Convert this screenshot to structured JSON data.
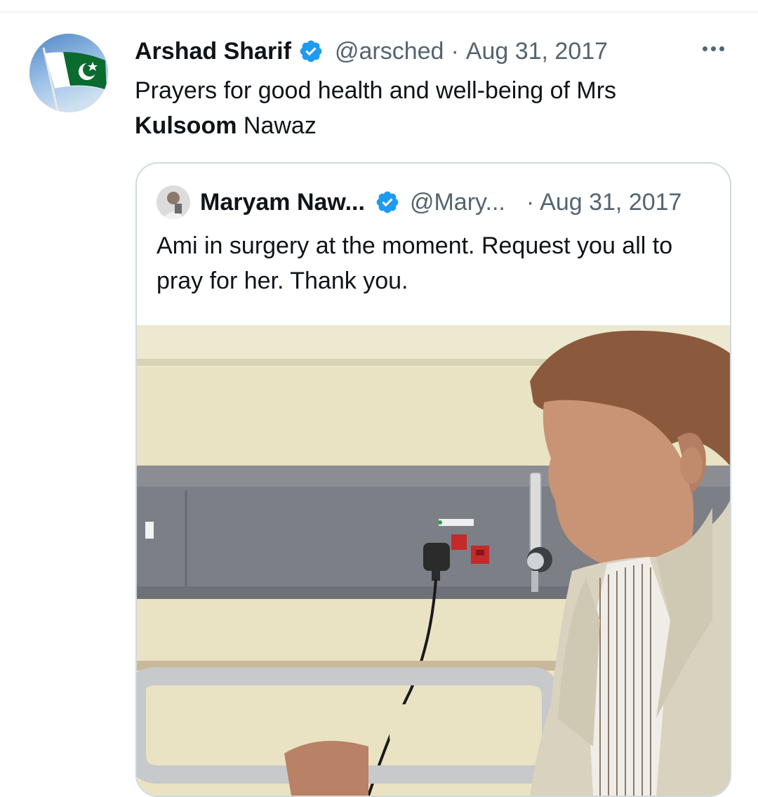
{
  "tweet": {
    "author_name": "Arshad Sharif",
    "handle": "@arsched",
    "separator": "·",
    "date": "Aug 31, 2017",
    "text_line1": "Prayers for good health and well-being of Mrs",
    "text_bold": "Kulsoom",
    "text_end": " Nawaz",
    "avatar_icon": "pakistan-flag-avatar",
    "more_icon": "more-options-icon"
  },
  "quote": {
    "author_name": "Maryam Naw...",
    "handle": "@Mary...",
    "separator": "·",
    "date": "Aug 31, 2017",
    "text": "Ami in surgery at the moment. Request you all to pray for her. Thank you.",
    "photo_icon": "hospital-room-photo"
  },
  "colors": {
    "verified_blue": "#1d9bf0",
    "text_primary": "#0f1419",
    "text_secondary": "#536471",
    "border": "#cfd9de"
  }
}
